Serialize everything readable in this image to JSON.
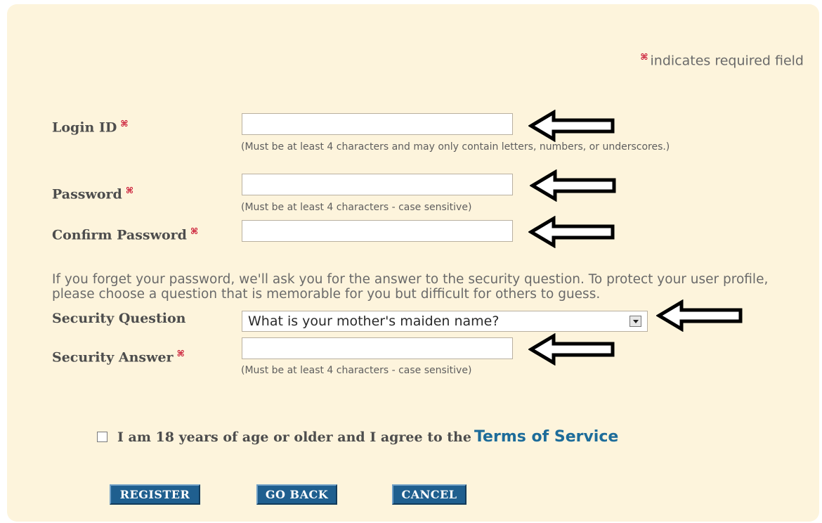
{
  "required_note": "indicates required field",
  "required_symbol": "⌘",
  "fields": {
    "login_id": {
      "label": "Login ID",
      "value": "",
      "hint": "(Must be at least 4 characters and may only contain letters, numbers, or underscores.)"
    },
    "password": {
      "label": "Password",
      "value": "",
      "hint": "(Must be at least 4 characters - case sensitive)"
    },
    "confirm_password": {
      "label": "Confirm Password",
      "value": ""
    },
    "security_question": {
      "label": "Security Question",
      "selected": "What is your mother's maiden name?"
    },
    "security_answer": {
      "label": "Security Answer",
      "value": "",
      "hint": "(Must be at least 4 characters - case sensitive)"
    }
  },
  "security_paragraph": "If you forget your password, we'll ask you for the answer to the security question. To protect your user profile, please choose a question that is memorable for you but difficult for others to guess.",
  "terms": {
    "text": "I am 18 years of age or older and I agree to the",
    "link": "Terms of Service",
    "checked": false
  },
  "buttons": {
    "register": "REGISTER",
    "go_back": "GO BACK",
    "cancel": "CANCEL"
  },
  "colors": {
    "panel_bg": "#fdf4dc",
    "required_mark": "#c8102e",
    "button_bg": "#1f5f8f",
    "link": "#1d6c9a"
  },
  "icons": {
    "arrow": "left-arrow-icon",
    "dropdown": "chevron-down-icon",
    "required": "required-asterisk-icon"
  }
}
